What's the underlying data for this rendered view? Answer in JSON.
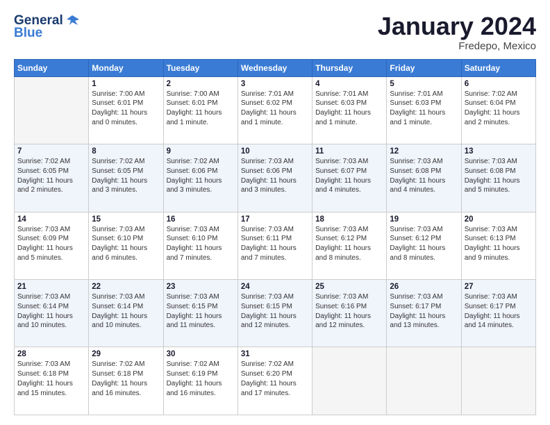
{
  "logo": {
    "part1": "General",
    "part2": "Blue"
  },
  "title": "January 2024",
  "location": "Fredepo, Mexico",
  "days_of_week": [
    "Sunday",
    "Monday",
    "Tuesday",
    "Wednesday",
    "Thursday",
    "Friday",
    "Saturday"
  ],
  "weeks": [
    [
      {
        "num": "",
        "info": ""
      },
      {
        "num": "1",
        "info": "Sunrise: 7:00 AM\nSunset: 6:01 PM\nDaylight: 11 hours\nand 0 minutes."
      },
      {
        "num": "2",
        "info": "Sunrise: 7:00 AM\nSunset: 6:01 PM\nDaylight: 11 hours\nand 1 minute."
      },
      {
        "num": "3",
        "info": "Sunrise: 7:01 AM\nSunset: 6:02 PM\nDaylight: 11 hours\nand 1 minute."
      },
      {
        "num": "4",
        "info": "Sunrise: 7:01 AM\nSunset: 6:03 PM\nDaylight: 11 hours\nand 1 minute."
      },
      {
        "num": "5",
        "info": "Sunrise: 7:01 AM\nSunset: 6:03 PM\nDaylight: 11 hours\nand 1 minute."
      },
      {
        "num": "6",
        "info": "Sunrise: 7:02 AM\nSunset: 6:04 PM\nDaylight: 11 hours\nand 2 minutes."
      }
    ],
    [
      {
        "num": "7",
        "info": "Sunrise: 7:02 AM\nSunset: 6:05 PM\nDaylight: 11 hours\nand 2 minutes."
      },
      {
        "num": "8",
        "info": "Sunrise: 7:02 AM\nSunset: 6:05 PM\nDaylight: 11 hours\nand 3 minutes."
      },
      {
        "num": "9",
        "info": "Sunrise: 7:02 AM\nSunset: 6:06 PM\nDaylight: 11 hours\nand 3 minutes."
      },
      {
        "num": "10",
        "info": "Sunrise: 7:03 AM\nSunset: 6:06 PM\nDaylight: 11 hours\nand 3 minutes."
      },
      {
        "num": "11",
        "info": "Sunrise: 7:03 AM\nSunset: 6:07 PM\nDaylight: 11 hours\nand 4 minutes."
      },
      {
        "num": "12",
        "info": "Sunrise: 7:03 AM\nSunset: 6:08 PM\nDaylight: 11 hours\nand 4 minutes."
      },
      {
        "num": "13",
        "info": "Sunrise: 7:03 AM\nSunset: 6:08 PM\nDaylight: 11 hours\nand 5 minutes."
      }
    ],
    [
      {
        "num": "14",
        "info": "Sunrise: 7:03 AM\nSunset: 6:09 PM\nDaylight: 11 hours\nand 5 minutes."
      },
      {
        "num": "15",
        "info": "Sunrise: 7:03 AM\nSunset: 6:10 PM\nDaylight: 11 hours\nand 6 minutes."
      },
      {
        "num": "16",
        "info": "Sunrise: 7:03 AM\nSunset: 6:10 PM\nDaylight: 11 hours\nand 7 minutes."
      },
      {
        "num": "17",
        "info": "Sunrise: 7:03 AM\nSunset: 6:11 PM\nDaylight: 11 hours\nand 7 minutes."
      },
      {
        "num": "18",
        "info": "Sunrise: 7:03 AM\nSunset: 6:12 PM\nDaylight: 11 hours\nand 8 minutes."
      },
      {
        "num": "19",
        "info": "Sunrise: 7:03 AM\nSunset: 6:12 PM\nDaylight: 11 hours\nand 8 minutes."
      },
      {
        "num": "20",
        "info": "Sunrise: 7:03 AM\nSunset: 6:13 PM\nDaylight: 11 hours\nand 9 minutes."
      }
    ],
    [
      {
        "num": "21",
        "info": "Sunrise: 7:03 AM\nSunset: 6:14 PM\nDaylight: 11 hours\nand 10 minutes."
      },
      {
        "num": "22",
        "info": "Sunrise: 7:03 AM\nSunset: 6:14 PM\nDaylight: 11 hours\nand 10 minutes."
      },
      {
        "num": "23",
        "info": "Sunrise: 7:03 AM\nSunset: 6:15 PM\nDaylight: 11 hours\nand 11 minutes."
      },
      {
        "num": "24",
        "info": "Sunrise: 7:03 AM\nSunset: 6:15 PM\nDaylight: 11 hours\nand 12 minutes."
      },
      {
        "num": "25",
        "info": "Sunrise: 7:03 AM\nSunset: 6:16 PM\nDaylight: 11 hours\nand 12 minutes."
      },
      {
        "num": "26",
        "info": "Sunrise: 7:03 AM\nSunset: 6:17 PM\nDaylight: 11 hours\nand 13 minutes."
      },
      {
        "num": "27",
        "info": "Sunrise: 7:03 AM\nSunset: 6:17 PM\nDaylight: 11 hours\nand 14 minutes."
      }
    ],
    [
      {
        "num": "28",
        "info": "Sunrise: 7:03 AM\nSunset: 6:18 PM\nDaylight: 11 hours\nand 15 minutes."
      },
      {
        "num": "29",
        "info": "Sunrise: 7:02 AM\nSunset: 6:18 PM\nDaylight: 11 hours\nand 16 minutes."
      },
      {
        "num": "30",
        "info": "Sunrise: 7:02 AM\nSunset: 6:19 PM\nDaylight: 11 hours\nand 16 minutes."
      },
      {
        "num": "31",
        "info": "Sunrise: 7:02 AM\nSunset: 6:20 PM\nDaylight: 11 hours\nand 17 minutes."
      },
      {
        "num": "",
        "info": ""
      },
      {
        "num": "",
        "info": ""
      },
      {
        "num": "",
        "info": ""
      }
    ]
  ]
}
